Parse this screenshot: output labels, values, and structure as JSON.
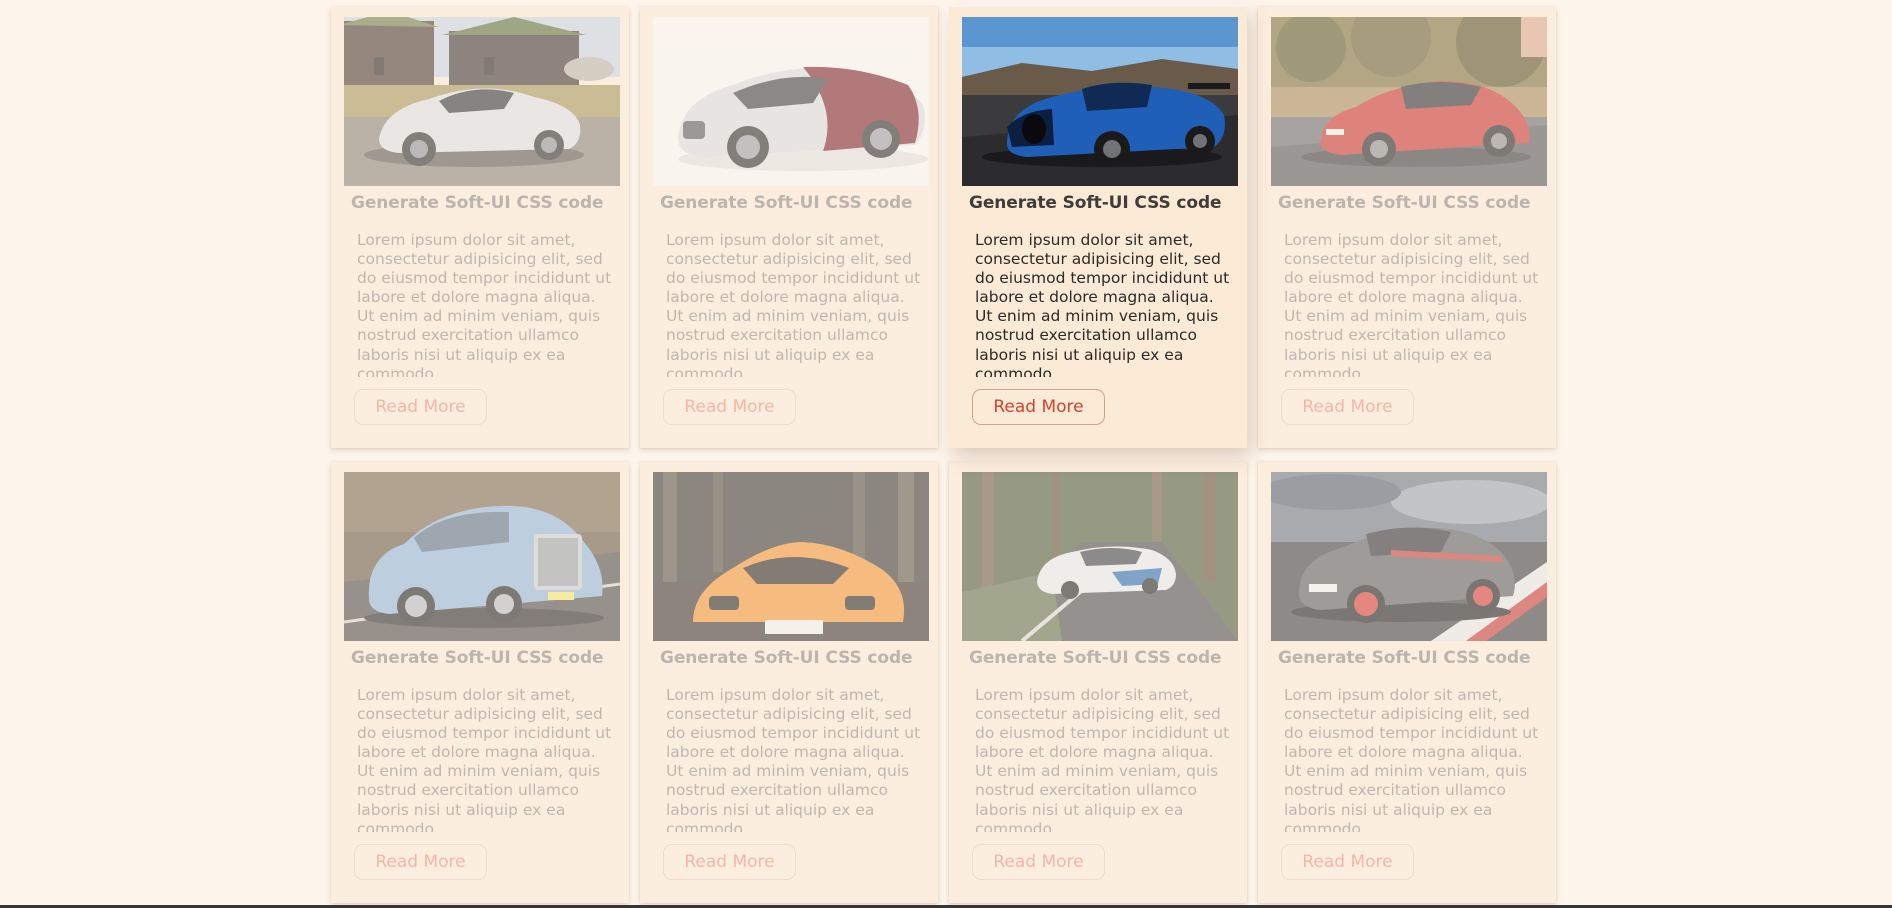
{
  "cards": [
    {
      "photo": "photo-silver-mclaren-supercar",
      "title": "Generate Soft-UI CSS code",
      "text": "Lorem ipsum dolor sit amet, consectetur adipisicing elit, sed do eiusmod tempor incididunt ut labore et dolore magna aliqua. Ut enim ad minim veniam, quis nostrud exercitation ullamco laboris nisi ut aliquip ex ea commodo",
      "button": "Read More"
    },
    {
      "photo": "photo-white-red-bugatti-chiron",
      "title": "Generate Soft-UI CSS code",
      "text": "Lorem ipsum dolor sit amet, consectetur adipisicing elit, sed do eiusmod tempor incididunt ut labore et dolore magna aliqua. Ut enim ad minim veniam, quis nostrud exercitation ullamco laboris nisi ut aliquip ex ea commodo",
      "button": "Read More"
    },
    {
      "photo": "photo-blue-bugatti-chiron",
      "title": "Generate Soft-UI CSS code",
      "text": "Lorem ipsum dolor sit amet, consectetur adipisicing elit, sed do eiusmod tempor incididunt ut labore et dolore magna aliqua. Ut enim ad minim veniam, quis nostrud exercitation ullamco laboris nisi ut aliquip ex ea commodo",
      "button": "Read More"
    },
    {
      "photo": "photo-red-porsche-911",
      "title": "Generate Soft-UI CSS code",
      "text": "Lorem ipsum dolor sit amet, consectetur adipisicing elit, sed do eiusmod tempor incididunt ut labore et dolore magna aliqua. Ut enim ad minim veniam, quis nostrud exercitation ullamco laboris nisi ut aliquip ex ea commodo",
      "button": "Read More"
    },
    {
      "photo": "photo-blue-rolls-royce-phantom",
      "title": "Generate Soft-UI CSS code",
      "text": "Lorem ipsum dolor sit amet, consectetur adipisicing elit, sed do eiusmod tempor incididunt ut labore et dolore magna aliqua. Ut enim ad minim veniam, quis nostrud exercitation ullamco laboris nisi ut aliquip ex ea commodo",
      "button": "Read More"
    },
    {
      "photo": "photo-orange-lamborghini-aventador",
      "title": "Generate Soft-UI CSS code",
      "text": "Lorem ipsum dolor sit amet, consectetur adipisicing elit, sed do eiusmod tempor incididunt ut labore et dolore magna aliqua. Ut enim ad minim veniam, quis nostrud exercitation ullamco laboris nisi ut aliquip ex ea commodo",
      "button": "Read More"
    },
    {
      "photo": "photo-white-bmw-vision-concept",
      "title": "Generate Soft-UI CSS code",
      "text": "Lorem ipsum dolor sit amet, consectetur adipisicing elit, sed do eiusmod tempor incididunt ut labore et dolore magna aliqua. Ut enim ad minim veniam, quis nostrud exercitation ullamco laboris nisi ut aliquip ex ea commodo",
      "button": "Read More"
    },
    {
      "photo": "photo-grey-bmw-m3-red-wheels",
      "title": "Generate Soft-UI CSS code",
      "text": "Lorem ipsum dolor sit amet, consectetur adipisicing elit, sed do eiusmod tempor incididunt ut labore et dolore magna aliqua. Ut enim ad minim veniam, quis nostrud exercitation ullamco laboris nisi ut aliquip ex ea commodo",
      "button": "Read More"
    }
  ],
  "colors": {
    "page_background": "#fdf5ec",
    "card_background": "#fbead6",
    "button_text": "#ec8a78",
    "button_text_active": "#d6422f",
    "title_text_active": "#403c3a"
  }
}
